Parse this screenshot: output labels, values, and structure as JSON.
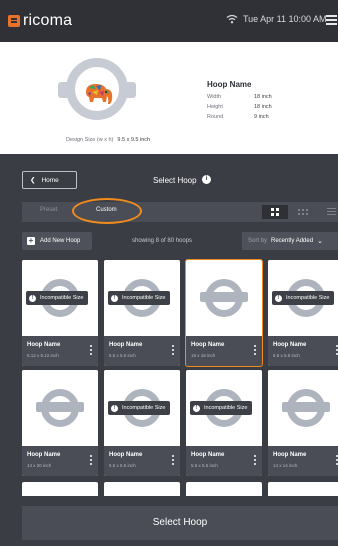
{
  "topbar": {
    "logo": "ricoma",
    "datetime": "Tue Apr 11  10:00 AM",
    "wifi_icon": "wifi-icon",
    "menu_icon": "hamburger-icon"
  },
  "preview": {
    "hoop_title": "Hoop Name",
    "specs": [
      {
        "label": "Width",
        "value": "18 inch"
      },
      {
        "label": "Height",
        "value": "18 inch"
      },
      {
        "label": "Round",
        "value": "9 inch"
      }
    ],
    "design_size_label": "Design Size (w x h)",
    "design_size_value": "9.5 x 9.5 inch"
  },
  "header": {
    "home_label": "Home",
    "title": "Select Hoop",
    "info_icon": "info-icon"
  },
  "tabs": {
    "preset": "Preset",
    "custom": "Custom",
    "active": "Custom"
  },
  "toolbar": {
    "add_label": "Add New Hoop",
    "showing": "showing 8 of 80 hoops",
    "sort_label": "Sort by",
    "sort_value": "Recently Added"
  },
  "badge_text": "Incompatible Size",
  "cards": [
    {
      "name": "Hoop Name",
      "size": "5.12 x 5.12 inch",
      "incompatible": true,
      "selected": false
    },
    {
      "name": "Hoop Name",
      "size": "5.5 x 5.5 inch",
      "incompatible": true,
      "selected": false
    },
    {
      "name": "Hoop Name",
      "size": "18 x 18 inch",
      "incompatible": false,
      "selected": true
    },
    {
      "name": "Hoop Name",
      "size": "5.5 x 5.5 inch",
      "incompatible": true,
      "selected": false
    },
    {
      "name": "Hoop Name",
      "size": "14 x 20 inch",
      "incompatible": false,
      "selected": false
    },
    {
      "name": "Hoop Name",
      "size": "5.5 x 5.5 inch",
      "incompatible": true,
      "selected": false
    },
    {
      "name": "Hoop Name",
      "size": "5.5 x 5.5 inch",
      "incompatible": true,
      "selected": false
    },
    {
      "name": "Hoop Name",
      "size": "14 x 14 inch",
      "incompatible": false,
      "selected": false
    }
  ],
  "select_button": "Select Hoop",
  "colors": {
    "accent": "#f08c1e",
    "topbar": "#2f3137",
    "panel": "#3a3d44"
  }
}
